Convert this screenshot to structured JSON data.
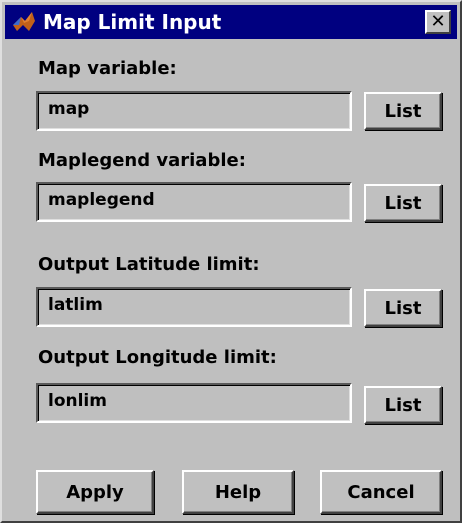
{
  "window": {
    "title": "Map Limit Input",
    "close_label": "✕"
  },
  "fields": [
    {
      "label": "Map variable:",
      "value": "map",
      "button": "List"
    },
    {
      "label": "Maplegend variable:",
      "value": "maplegend",
      "button": "List"
    },
    {
      "label": "Output Latitude limit:",
      "value": "latlim",
      "button": "List"
    },
    {
      "label": "Output Longitude limit:",
      "value": "lonlim",
      "button": "List"
    }
  ],
  "buttons": {
    "apply": "Apply",
    "help": "Help",
    "cancel": "Cancel"
  },
  "colors": {
    "titlebar": "#000080",
    "face": "#c0c0c0"
  }
}
